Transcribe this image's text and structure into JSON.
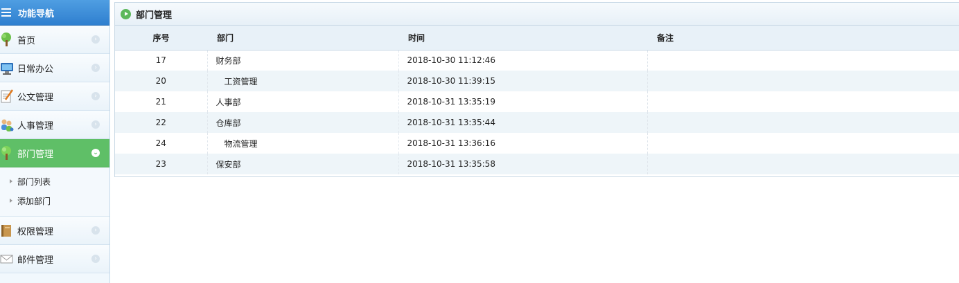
{
  "sidebar": {
    "title": "功能导航",
    "items": [
      {
        "label": "首页",
        "icon": "tree-icon"
      },
      {
        "label": "日常办公",
        "icon": "monitor-icon"
      },
      {
        "label": "公文管理",
        "icon": "document-pen-icon"
      },
      {
        "label": "人事管理",
        "icon": "people-icon"
      },
      {
        "label": "部门管理",
        "icon": "tree-icon",
        "active": true
      },
      {
        "label": "权限管理",
        "icon": "book-icon"
      },
      {
        "label": "邮件管理",
        "icon": "envelope-icon"
      }
    ],
    "submenu": [
      {
        "label": "部门列表"
      },
      {
        "label": "添加部门"
      }
    ]
  },
  "panel": {
    "title": "部门管理"
  },
  "table": {
    "headers": {
      "id": "序号",
      "dept": "部门",
      "time": "时间",
      "note": "备注"
    },
    "rows": [
      {
        "id": "17",
        "dept": "财务部",
        "time": "2018-10-30 11:12:46",
        "note": ""
      },
      {
        "id": "20",
        "dept": "工资管理",
        "time": "2018-10-30 11:39:15",
        "note": "",
        "sub": true
      },
      {
        "id": "21",
        "dept": "人事部",
        "time": "2018-10-31 13:35:19",
        "note": ""
      },
      {
        "id": "22",
        "dept": "仓库部",
        "time": "2018-10-31 13:35:44",
        "note": ""
      },
      {
        "id": "24",
        "dept": "物流管理",
        "time": "2018-10-31 13:36:16",
        "note": "",
        "sub": true
      },
      {
        "id": "23",
        "dept": "保安部",
        "time": "2018-10-31 13:35:58",
        "note": ""
      }
    ]
  },
  "colors": {
    "header_blue": "#3b8ad8",
    "active_green": "#5fbf67",
    "row_alt": "#eef5f9"
  }
}
